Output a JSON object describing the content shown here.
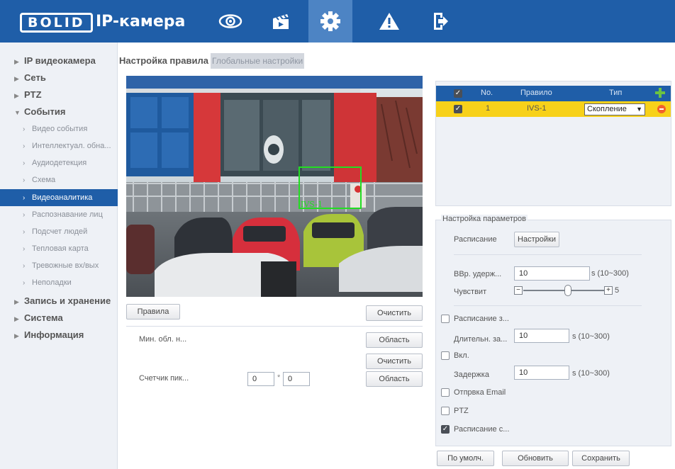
{
  "header": {
    "logo_text": "BOLID",
    "title": "IP-камера",
    "nav_icons": [
      "eye-icon",
      "clapperboard-icon",
      "gear-icon",
      "warning-icon",
      "logout-icon"
    ],
    "active_nav": "gear-icon",
    "color": "#1f5ea8"
  },
  "sidebar": {
    "sections": [
      {
        "label": "IP видеокамера",
        "expanded": false
      },
      {
        "label": "Сеть",
        "expanded": false
      },
      {
        "label": "PTZ",
        "expanded": false
      },
      {
        "label": "События",
        "expanded": true
      },
      {
        "label": "Запись и хранение",
        "expanded": false
      },
      {
        "label": "Система",
        "expanded": false
      },
      {
        "label": "Информация",
        "expanded": false
      }
    ],
    "event_items": [
      "Видео события",
      "Интеллектуал. обна...",
      "Аудиодетекция",
      "Схема",
      "Видеоаналитика",
      "Распознавание лиц",
      "Подсчет людей",
      "Тепловая карта",
      "Тревожные вх/вых",
      "Неполадки"
    ],
    "active_item": "Видеоаналитика"
  },
  "tabs": {
    "active": "Настройка правила",
    "inactive": "Глобальные настройки"
  },
  "camera": {
    "rule_label": "IVS-1",
    "rule_box_color": "#22dd22"
  },
  "left_controls": {
    "rules_button": "Правила",
    "clear_button_1": "Очистить",
    "min_area_label": "Мин. обл. н...",
    "area_button_1": "Область",
    "clear_button_2": "Очистить",
    "pixel_counter_label": "Счетчик пик...",
    "pixel_width": "0",
    "pixel_separator": "*",
    "pixel_height": "0",
    "area_button_2": "Область"
  },
  "rule_table": {
    "headers": {
      "no": "No.",
      "rule": "Правило",
      "type": "Тип"
    },
    "rows": [
      {
        "checked": true,
        "no": "1",
        "rule": "IVS-1",
        "type": "Скопление"
      }
    ],
    "row_color": "#f7d11a"
  },
  "params": {
    "title": "Настройка параметров",
    "schedule_label": "Расписание",
    "settings_button": "Настройки",
    "hold_time_label": "ВВр. удерж...",
    "hold_time_value": "10",
    "hold_time_range": "s (10~300)",
    "sensitivity_label": "Чувствит",
    "sensitivity_value": "5",
    "sensitivity_level": 0.55,
    "schedule_record": {
      "label": "Расписание з...",
      "checked": false
    },
    "record_duration_label": "Длительн. за...",
    "record_duration_value": "10",
    "record_duration_range": "s (10~300)",
    "enable": {
      "label": "Вкл.",
      "checked": false
    },
    "delay_label": "Задержка",
    "delay_value": "10",
    "delay_range": "s (10~300)",
    "send_email": {
      "label": "Отпрвка Email",
      "checked": false
    },
    "ptz": {
      "label": "PTZ",
      "checked": false
    },
    "schedule_snapshot": {
      "label": "Расписание с...",
      "checked": true
    }
  },
  "bottom_buttons": {
    "default": "По умолч.",
    "refresh": "Обновить",
    "save": "Сохранить"
  }
}
